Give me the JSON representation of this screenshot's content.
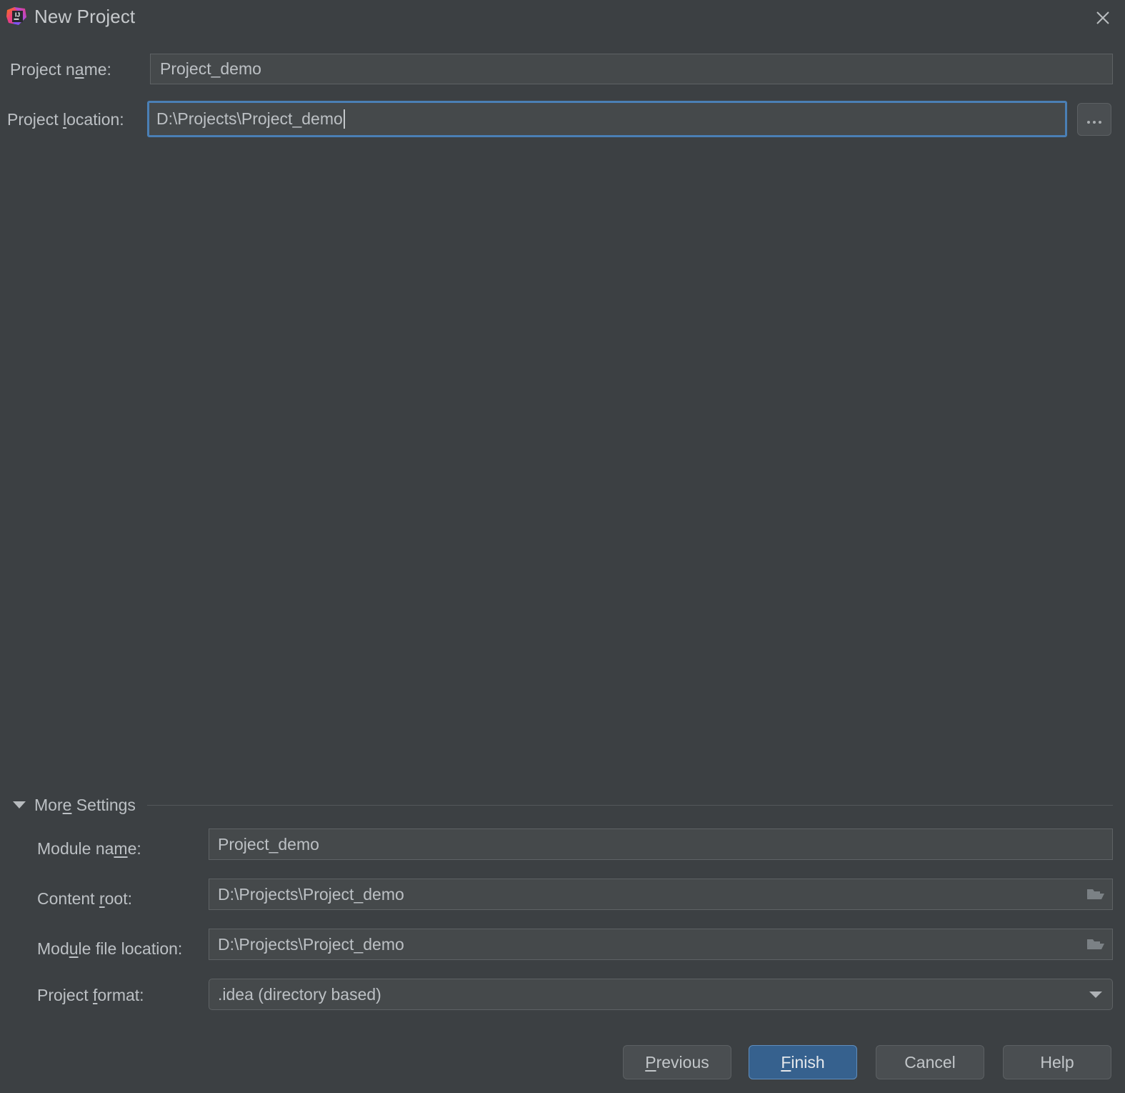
{
  "window": {
    "title": "New Project",
    "logo_icon": "intellij-idea-logo",
    "close_icon": "close-icon"
  },
  "form": {
    "project_name": {
      "label_before": "Project n",
      "label_mnemonic": "a",
      "label_after": "me:",
      "value": "Project_demo"
    },
    "project_location": {
      "label_before": "Project ",
      "label_mnemonic": "l",
      "label_after": "ocation:",
      "value": "D:\\Projects\\Project_demo",
      "focused": true
    },
    "browse_button": {
      "label": "...",
      "icon": "ellipsis-icon"
    }
  },
  "more_settings": {
    "label_before": "Mor",
    "label_mnemonic": "e",
    "label_after": " Settings",
    "expanded": true,
    "triangle_icon": "triangle-down-icon",
    "rows": [
      {
        "label_before": "Module na",
        "label_mnemonic": "m",
        "label_after": "e:",
        "value": "Project_demo",
        "trailing_icon": "",
        "type": "text"
      },
      {
        "label_before": "Content ",
        "label_mnemonic": "r",
        "label_after": "oot:",
        "value": "D:\\Projects\\Project_demo",
        "trailing_icon": "folder-icon",
        "type": "text"
      },
      {
        "label_before": "Mod",
        "label_mnemonic": "u",
        "label_after": "le file location:",
        "value": "D:\\Projects\\Project_demo",
        "trailing_icon": "folder-icon",
        "type": "text"
      },
      {
        "label_before": "Project ",
        "label_mnemonic": "f",
        "label_after": "ormat:",
        "value": ".idea (directory based)",
        "trailing_icon": "chevron-down-icon",
        "type": "combo"
      }
    ]
  },
  "buttons": [
    {
      "name": "previous",
      "label_before": "",
      "label_mnemonic": "P",
      "label_after": "revious",
      "primary": false
    },
    {
      "name": "finish",
      "label_before": "",
      "label_mnemonic": "F",
      "label_after": "inish",
      "primary": true
    },
    {
      "name": "cancel",
      "label_before": "Cancel",
      "label_mnemonic": "",
      "label_after": "",
      "primary": false
    },
    {
      "name": "help",
      "label_before": "Help",
      "label_mnemonic": "",
      "label_after": "",
      "primary": false
    }
  ],
  "colors": {
    "dialog_background": "#3c4043",
    "field_background": "#45494b",
    "field_border": "#5e6265",
    "focus_blue": "#4a7fb5",
    "primary_button": "#36618e",
    "text": "#bcc0c4"
  }
}
